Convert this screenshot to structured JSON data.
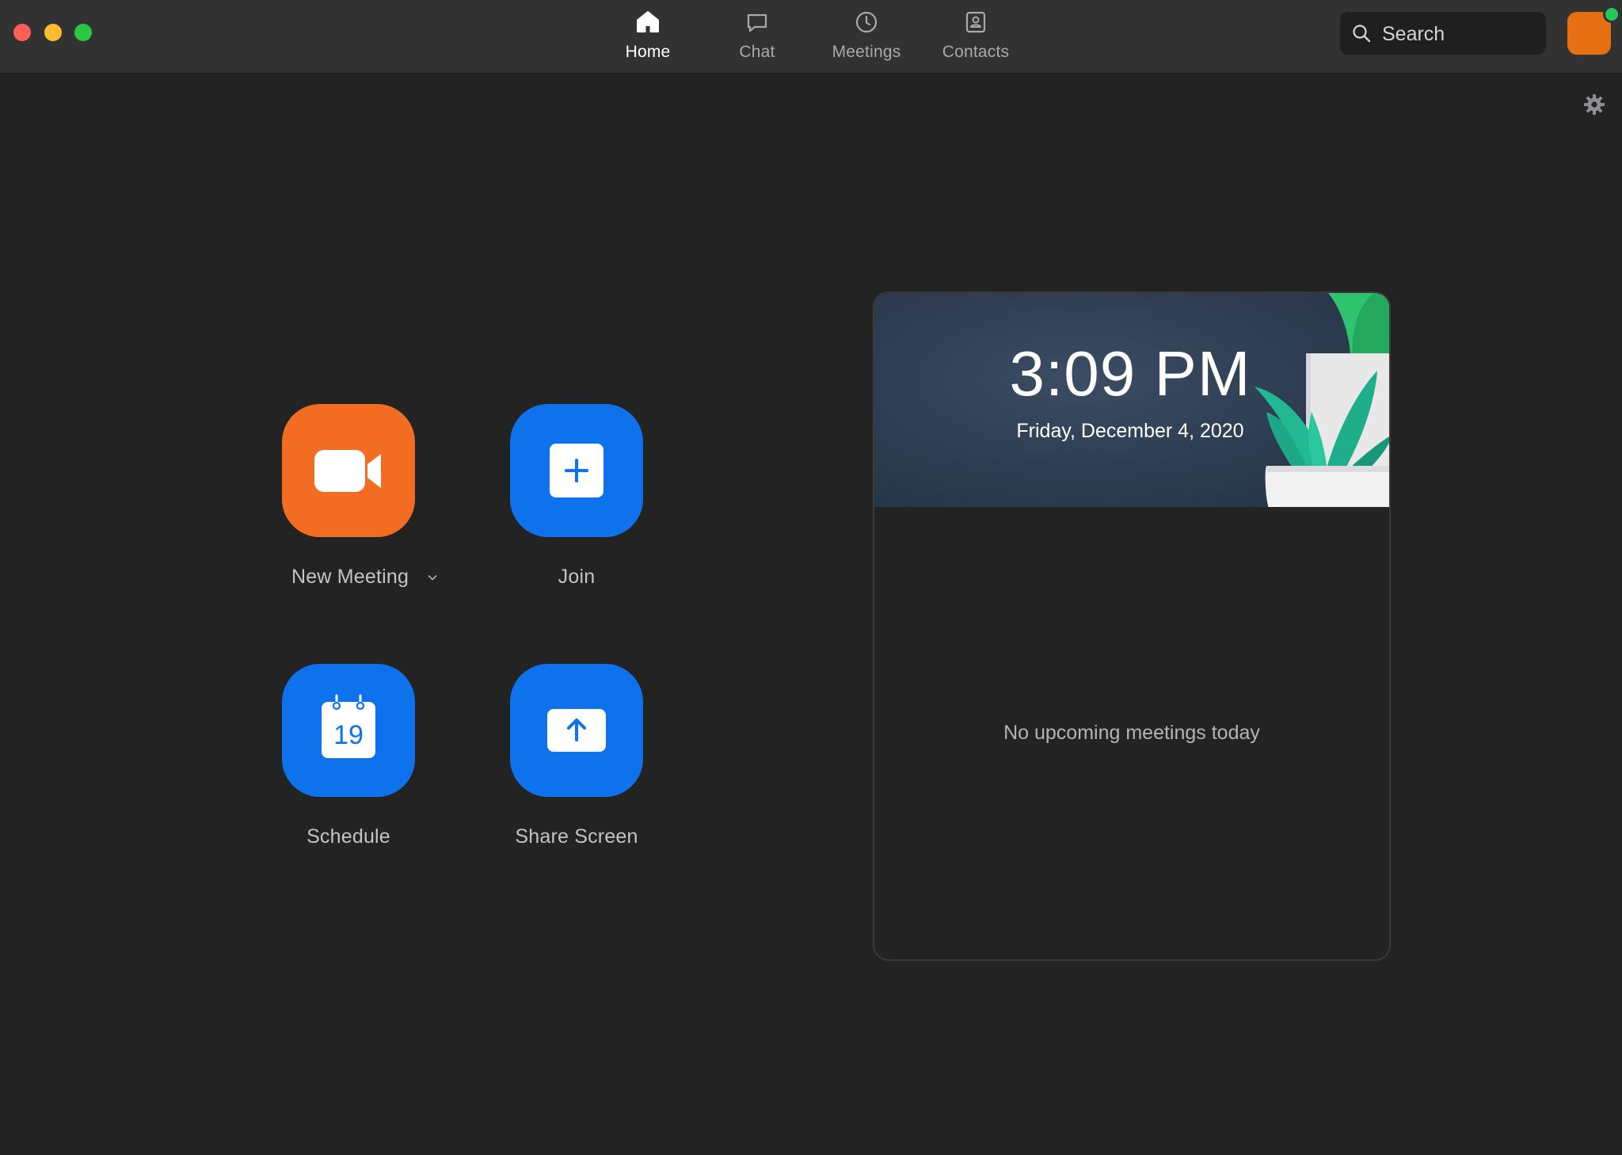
{
  "window": {
    "controls": {
      "close_color": "#fe5f57",
      "minimize_color": "#febc2e",
      "maximize_color": "#28c840"
    }
  },
  "nav": {
    "tabs": [
      {
        "label": "Home",
        "icon": "home-icon",
        "active": true
      },
      {
        "label": "Chat",
        "icon": "chat-bubble-icon",
        "active": false
      },
      {
        "label": "Meetings",
        "icon": "clock-icon",
        "active": false
      },
      {
        "label": "Contacts",
        "icon": "contact-card-icon",
        "active": false
      }
    ]
  },
  "search": {
    "placeholder": "Search",
    "icon": "search-icon"
  },
  "account": {
    "avatar_color": "#e86f10",
    "presence_color": "#27c65a",
    "presence": "available"
  },
  "settings": {
    "icon": "gear-icon"
  },
  "actions": {
    "new_meeting": {
      "label": "New Meeting",
      "icon": "video-camera-icon",
      "color": "#f26d22"
    },
    "join": {
      "label": "Join",
      "icon": "plus-icon",
      "color": "#0e72ed"
    },
    "schedule": {
      "label": "Schedule",
      "icon": "calendar-icon",
      "calendar_day": "19",
      "color": "#0e72ed"
    },
    "share_screen": {
      "label": "Share Screen",
      "icon": "share-arrow-icon",
      "color": "#0e72ed"
    }
  },
  "clock_card": {
    "time": "3:09 PM",
    "date": "Friday, December 4, 2020",
    "empty_message": "No upcoming meetings today"
  }
}
